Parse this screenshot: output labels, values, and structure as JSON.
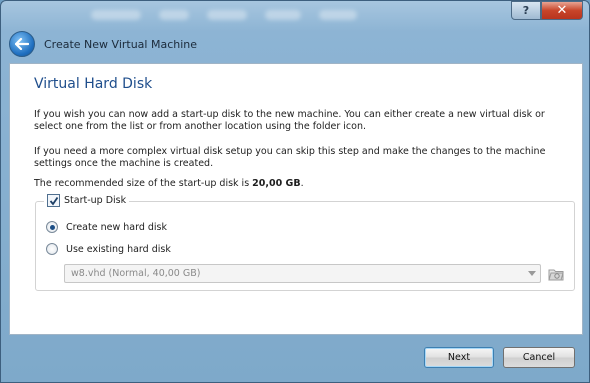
{
  "window": {
    "help_label": "?",
    "close_label": "✕",
    "title": "Create New Virtual Machine"
  },
  "page": {
    "title": "Virtual Hard Disk",
    "paragraph1": "If you wish you can now add a start-up disk to the new machine. You can either create a new virtual disk or select one from the list or from another location using the folder icon.",
    "paragraph2": "If you need a more complex virtual disk setup you can skip this step and make the changes to the machine settings once the machine is created.",
    "recommended_prefix": "The recommended size of the start-up disk is ",
    "recommended_size": "20,00 GB",
    "recommended_suffix": "."
  },
  "startup_disk": {
    "label": "Start-up Disk",
    "checked": true,
    "option_create": "Create new hard disk",
    "option_existing": "Use existing hard disk",
    "selected_option": "create",
    "existing_disk_value": "w8.vhd (Normal, 40,00 GB)"
  },
  "buttons": {
    "next": "Next",
    "cancel": "Cancel"
  },
  "colors": {
    "title_blue": "#1f4e8c",
    "close_red": "#c8452a",
    "frame_blue": "#8db4d4"
  }
}
